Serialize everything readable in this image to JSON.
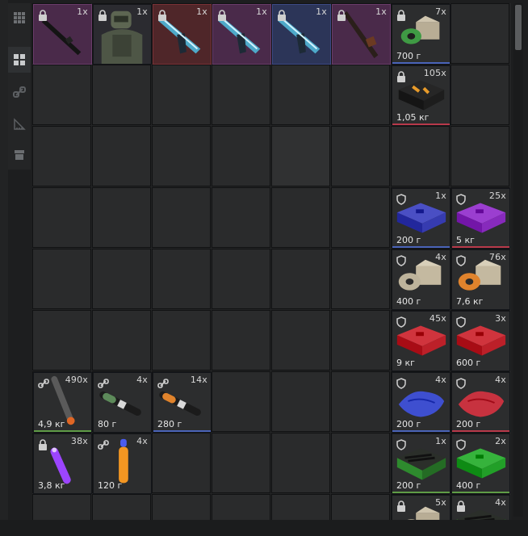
{
  "colors": {
    "bg": "#1d1e1f",
    "cell": "#2a2b2c",
    "bar_green": "#5f9c46",
    "bar_blue": "#4a63b8",
    "bar_red": "#b8394a",
    "tint_purple": "#4a2a4a",
    "tint_red": "#4f2629",
    "tint_blue": "#2c3558"
  },
  "tabs": [
    {
      "icon": "grid-small-icon",
      "active": false
    },
    {
      "icon": "grid-icon",
      "active": true
    },
    {
      "icon": "link-icon",
      "active": false
    },
    {
      "icon": "ruler-icon",
      "active": false
    },
    {
      "icon": "box-icon",
      "active": false
    }
  ],
  "items": {
    "gun_rifle": {
      "count": "1x",
      "icon": "rifle-icon"
    },
    "armor": {
      "count": "1x",
      "icon": "armored-soldier-icon"
    },
    "blaster_red": {
      "count": "1x",
      "icon": "energy-gun-icon"
    },
    "blaster_purple": {
      "count": "1x",
      "icon": "energy-gun-icon"
    },
    "blaster_blue": {
      "count": "1x",
      "icon": "energy-gun-icon"
    },
    "shotgun": {
      "count": "1x",
      "icon": "shotgun-icon"
    },
    "green_box": {
      "count": "7x",
      "weight": "700 г",
      "icon": "supply-box-icon"
    },
    "black_case": {
      "count": "105x",
      "weight": "1,05 кг",
      "icon": "ammo-case-icon"
    },
    "blue_case": {
      "count": "1x",
      "weight": "200 г",
      "icon": "case-icon"
    },
    "purple_case": {
      "count": "25x",
      "weight": "5 кг",
      "icon": "case-icon"
    },
    "tape_box": {
      "count": "4x",
      "weight": "400 г",
      "icon": "tape-box-icon"
    },
    "orange_tape_box": {
      "count": "76x",
      "weight": "7,6 кг",
      "icon": "tape-box-icon"
    },
    "red_case_a": {
      "count": "45x",
      "weight": "9 кг",
      "icon": "case-icon"
    },
    "red_case_b": {
      "count": "3x",
      "weight": "600 г",
      "icon": "case-icon"
    },
    "blue_cloth": {
      "count": "4x",
      "weight": "200 г",
      "icon": "cloth-icon"
    },
    "red_cloth": {
      "count": "4x",
      "weight": "200 г",
      "icon": "cloth-icon"
    },
    "stick_a": {
      "count": "490x",
      "weight": "4,9 кг",
      "icon": "stick-icon"
    },
    "syringe_a": {
      "count": "4x",
      "weight": "80 г",
      "icon": "syringe-icon"
    },
    "syringe_b": {
      "count": "14x",
      "weight": "280 г",
      "icon": "syringe-icon"
    },
    "glowstick": {
      "count": "38x",
      "weight": "3,8 кг",
      "icon": "glowstick-icon"
    },
    "orange_vial": {
      "count": "4x",
      "weight": "120 г",
      "icon": "vial-icon"
    },
    "green_crate": {
      "count": "1x",
      "weight": "200 г",
      "icon": "crate-icon"
    },
    "green_case": {
      "count": "2x",
      "weight": "400 г",
      "icon": "case-icon"
    },
    "partial_box": {
      "count": "5x"
    },
    "partial_green": {
      "count": "4x"
    }
  }
}
